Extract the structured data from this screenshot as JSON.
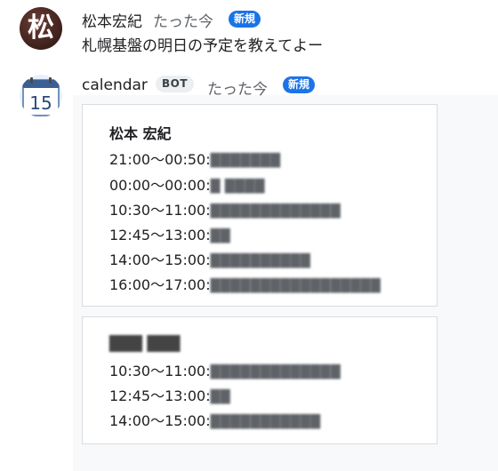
{
  "user_message": {
    "sender": "松本宏紀",
    "avatar_char": "松",
    "time": "たった今",
    "badge": "新規",
    "text": "札幌基盤の明日の予定を教えてよー"
  },
  "bot_message": {
    "sender": "calendar",
    "bot_badge": "BOT",
    "time": "たった今",
    "badge": "新規",
    "avatar_day": "15",
    "cards": [
      {
        "title": "松本 宏紀",
        "events": [
          {
            "time": "21:00〜00:50:",
            "title": "███████"
          },
          {
            "time": "00:00〜00:00:",
            "title": "█ ████"
          },
          {
            "time": "10:30〜11:00:",
            "title": "█████████████"
          },
          {
            "time": "12:45〜13:00:",
            "title": "██"
          },
          {
            "time": "14:00〜15:00:",
            "title": "██████████"
          },
          {
            "time": "16:00〜17:00:",
            "title": "█████████████████"
          }
        ]
      },
      {
        "title": "███ ███",
        "events": [
          {
            "time": "10:30〜11:00:",
            "title": "█████████████"
          },
          {
            "time": "12:45〜13:00:",
            "title": "██"
          },
          {
            "time": "14:00〜15:00:",
            "title": "███████████"
          }
        ]
      }
    ]
  },
  "colors": {
    "accent_blue": "#1a73e8",
    "bot_area_bg": "#f8f9fa",
    "card_border": "#dadce0",
    "text_primary": "#202124",
    "text_secondary": "#5f6368"
  }
}
